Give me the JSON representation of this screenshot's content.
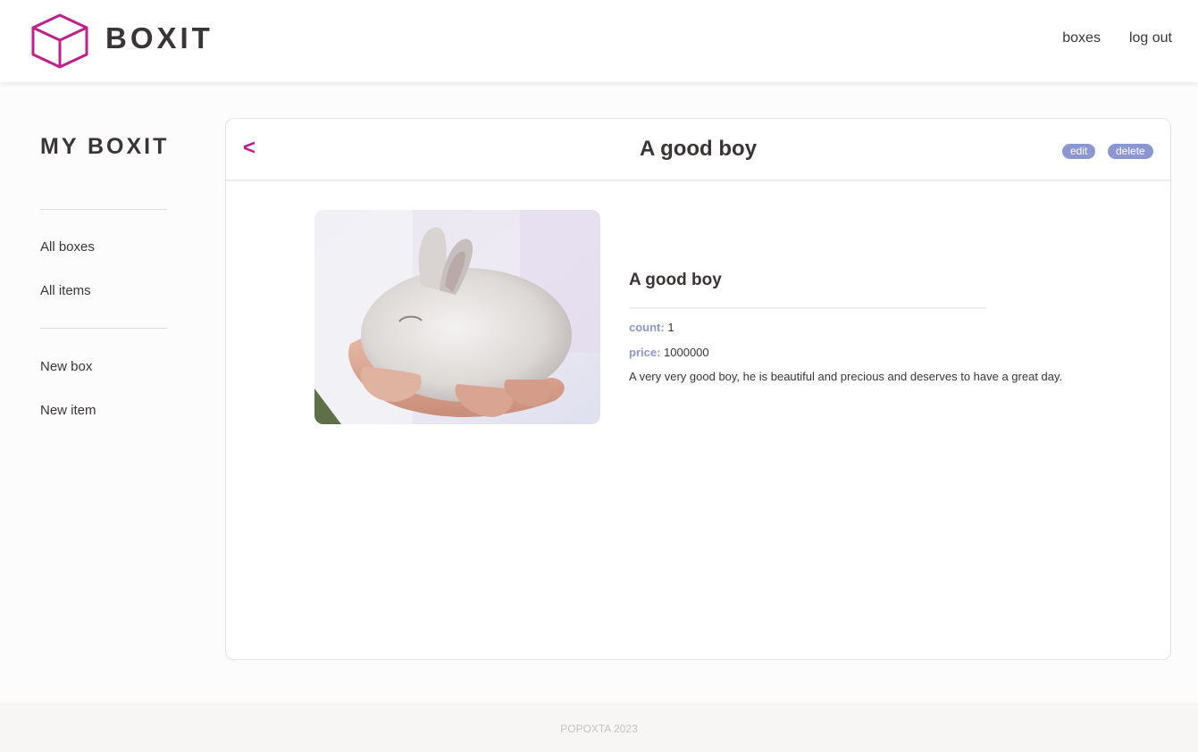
{
  "app": {
    "logo_text": "BOXIT",
    "accent_color": "#c0208a",
    "pill_color": "#8b97d0"
  },
  "nav": {
    "items": [
      {
        "label": "boxes"
      },
      {
        "label": "log out"
      }
    ]
  },
  "sidebar": {
    "title": "MY BOXIT",
    "browse_links": [
      {
        "label": "All boxes"
      },
      {
        "label": "All items"
      }
    ],
    "create_links": [
      {
        "label": "New box"
      },
      {
        "label": "New item"
      }
    ]
  },
  "panel": {
    "back_label": "<",
    "title": "A good boy",
    "edit_label": "edit",
    "delete_label": "delete"
  },
  "item": {
    "name": "A good boy",
    "count_label": "count:",
    "count_value": "1",
    "price_label": "price:",
    "price_value": "1000000",
    "description": "A very very good boy, he is beautiful and precious and deserves to have a great day."
  },
  "footer": {
    "text": "POPOXTA 2023"
  }
}
